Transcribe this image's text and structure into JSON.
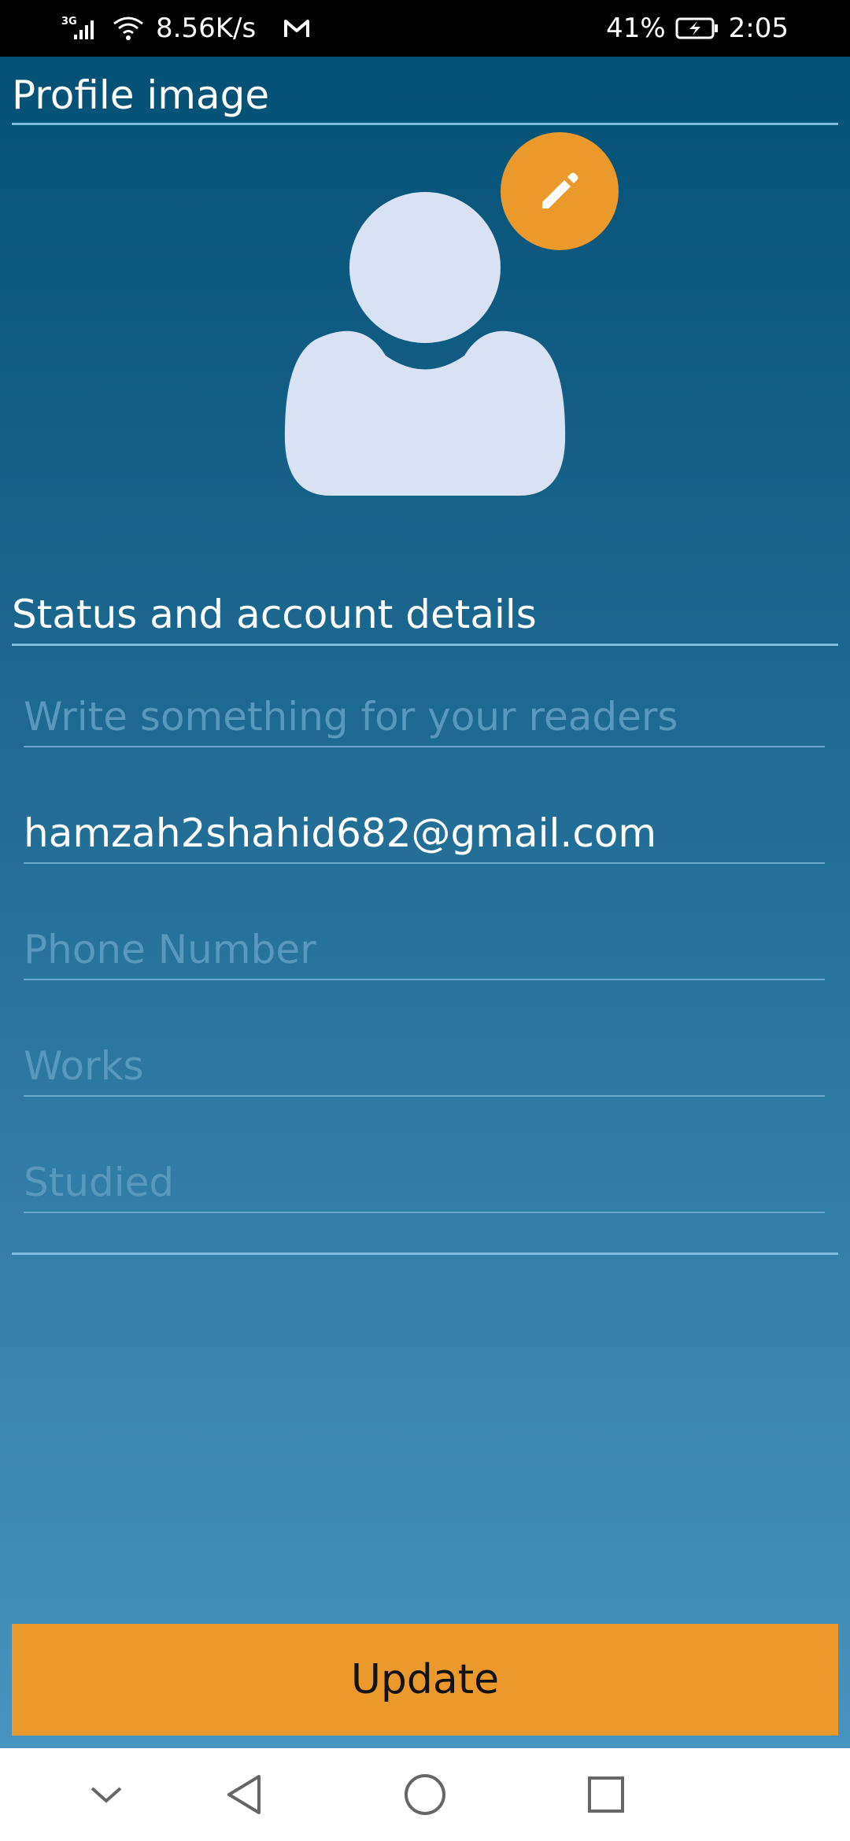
{
  "status_bar": {
    "network_type": "3G",
    "speed": "8.56K/s",
    "battery": "41%",
    "time": "2:05",
    "icons": [
      "signal-icon",
      "wifi-icon",
      "gmail-icon",
      "battery-charging-icon"
    ]
  },
  "profile_section": {
    "title": "Profile image",
    "avatar_icon": "user-silhouette-icon",
    "edit_icon": "pencil-icon"
  },
  "details_section": {
    "title": "Status and account details",
    "fields": [
      {
        "name": "status",
        "value": "",
        "placeholder": "Write something for your readers"
      },
      {
        "name": "email",
        "value": "hamzah2shahid682@gmail.com",
        "placeholder": ""
      },
      {
        "name": "phone",
        "value": "",
        "placeholder": "Phone Number"
      },
      {
        "name": "works",
        "value": "",
        "placeholder": "Works"
      },
      {
        "name": "studied",
        "value": "",
        "placeholder": "Studied"
      }
    ]
  },
  "update_button": {
    "label": "Update"
  },
  "colors": {
    "accent": "#ec992b",
    "background_top": "#045176",
    "background_bottom": "#4694bf"
  },
  "nav_bar": {
    "icons": [
      "chevron-down-icon",
      "back-icon",
      "home-icon",
      "recents-icon"
    ]
  }
}
